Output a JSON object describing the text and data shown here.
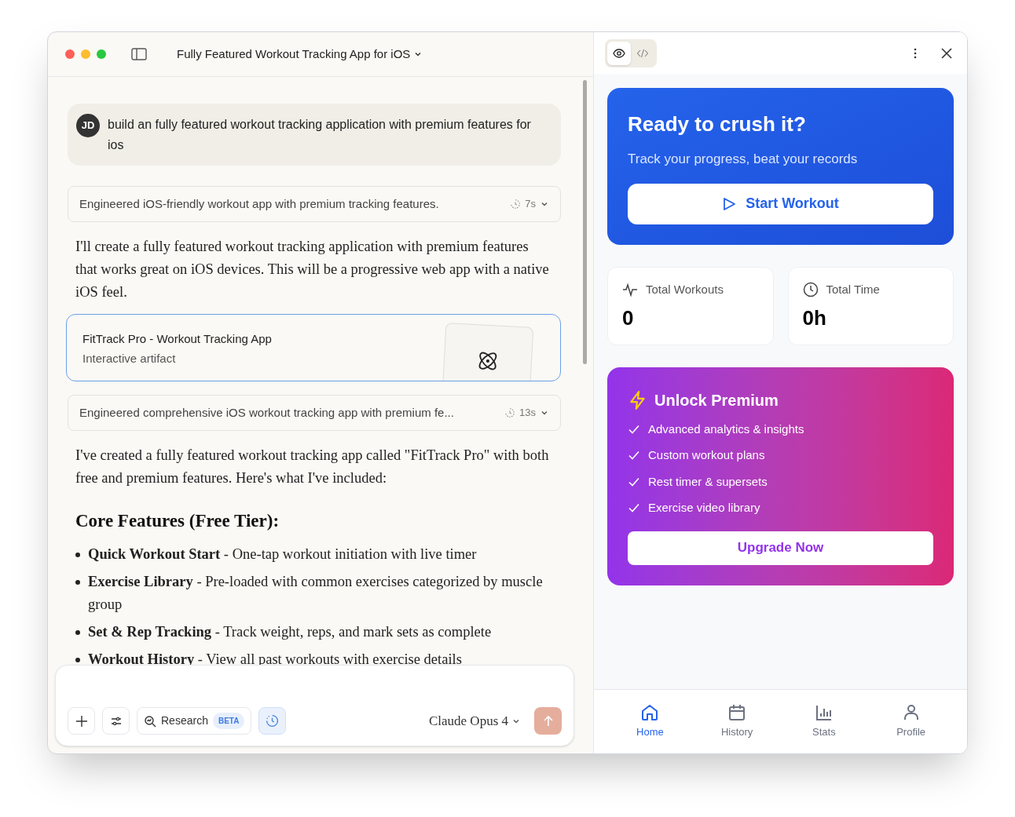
{
  "window": {
    "title": "Fully Featured Workout Tracking App for iOS"
  },
  "chat": {
    "user_message": {
      "avatar": "JD",
      "text": "build an fully featured workout tracking application with premium features for ios"
    },
    "messages": [
      {
        "kind": "thinking",
        "text": "Engineered iOS-friendly workout app with premium tracking features.",
        "time": "7s"
      },
      {
        "kind": "paragraph",
        "text": "I'll create a fully featured workout tracking application with premium features that works great on iOS devices. This will be a progressive web app with a native iOS feel."
      },
      {
        "kind": "artifact",
        "title": "FitTrack Pro - Workout Tracking App",
        "subtitle": "Interactive artifact"
      },
      {
        "kind": "thinking",
        "text": "Engineered comprehensive iOS workout tracking app with premium fe...",
        "time": "13s"
      },
      {
        "kind": "paragraph",
        "text": "I've created a fully featured workout tracking app called \"FitTrack Pro\" with both free and premium features. Here's what I've included:"
      },
      {
        "kind": "heading",
        "text": "Core Features (Free Tier):"
      },
      {
        "kind": "bullets",
        "items": [
          "**Quick Workout Start** - One-tap workout initiation with live timer",
          "**Exercise Library** - Pre-loaded with common exercises categorized by muscle group",
          "**Set & Rep Tracking** - Track weight, reps, and mark sets as complete",
          "**Workout History** - View all past workouts with exercise details"
        ]
      }
    ]
  },
  "composer": {
    "research_label": "Research",
    "research_badge": "BETA",
    "model": "Claude Opus 4"
  },
  "preview": {
    "view_toggle": [
      {
        "kind": "preview",
        "selected": true
      },
      {
        "kind": "code",
        "selected": false
      }
    ],
    "hero": {
      "title": "Ready to crush it?",
      "subtitle": "Track your progress, beat your records",
      "button": "Start Workout"
    },
    "stats": [
      {
        "kind": "activity",
        "label": "Total Workouts",
        "value": "0"
      },
      {
        "kind": "clock",
        "label": "Total Time",
        "value": "0h"
      }
    ],
    "premium": {
      "title": "Unlock Premium",
      "features": [
        "Advanced analytics & insights",
        "Custom workout plans",
        "Rest timer & supersets",
        "Exercise video library"
      ],
      "button": "Upgrade Now"
    },
    "nav": [
      {
        "kind": "home",
        "label": "Home",
        "selected": true
      },
      {
        "kind": "calendar",
        "label": "History",
        "selected": false
      },
      {
        "kind": "chart",
        "label": "Stats",
        "selected": false
      },
      {
        "kind": "person",
        "label": "Profile",
        "selected": false
      }
    ]
  }
}
